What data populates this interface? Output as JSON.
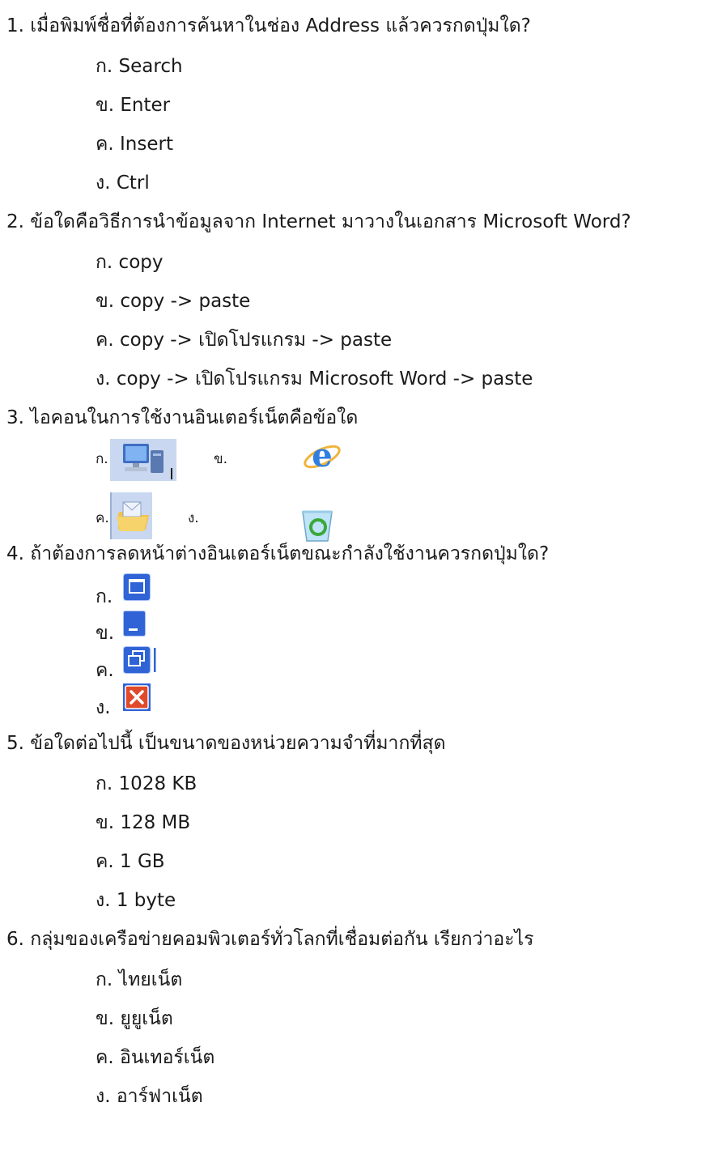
{
  "questions": [
    {
      "number": "1.",
      "text": "เมื่อพิมพ์ชื่อที่ต้องการค้นหาในช่อง Address แล้วควรกดปุ่มใด?",
      "options": [
        "ก. Search",
        "ข. Enter",
        "ค. Insert",
        "ง. Ctrl"
      ]
    },
    {
      "number": "2.",
      "text": "ข้อใดคือวิธีการนำข้อมูลจาก Internet มาวางในเอกสาร Microsoft Word?",
      "options": [
        "ก. copy",
        "ข. copy -> paste",
        "ค. copy -> เปิดโปรแกรม -> paste",
        "ง. copy -> เปิดโปรแกรม Microsoft Word -> paste"
      ]
    },
    {
      "number": "3.",
      "text": "ไอคอนในการใช้งานอินเตอร์เน็ตคือข้อใด",
      "options": [
        "ก.",
        "ข.",
        "ค.",
        "ง."
      ],
      "icons": [
        "my-computer-icon",
        "internet-explorer-icon",
        "folder-envelope-icon",
        "recycle-bin-icon"
      ]
    },
    {
      "number": "4.",
      "text": "ถ้าต้องการลดหน้าต่างอินเตอร์เน็ตขณะกำลังใช้งานควรกดปุ่มใด?",
      "options": [
        "ก.",
        "ข.",
        "ค.",
        "ง."
      ],
      "icons": [
        "maximize-icon",
        "minimize-icon",
        "restore-icon",
        "close-icon"
      ]
    },
    {
      "number": "5.",
      "text": "ข้อใดต่อไปนี้ เป็นขนาดของหน่วยความจำที่มากที่สุด",
      "options": [
        "ก. 1028 KB",
        "ข. 128 MB",
        "ค. 1 GB",
        "ง. 1 byte"
      ]
    },
    {
      "number": "6.",
      "text": "กลุ่มของเครือข่ายคอมพิวเตอร์ทั่วโลกที่เชื่อมต่อกัน เรียกว่าอะไร",
      "options": [
        "ก. ไทยเน็ต",
        "ข. ยูยูเน็ต",
        "ค. อินเทอร์เน็ต",
        "ง. อาร์ฟาเน็ต"
      ]
    }
  ]
}
